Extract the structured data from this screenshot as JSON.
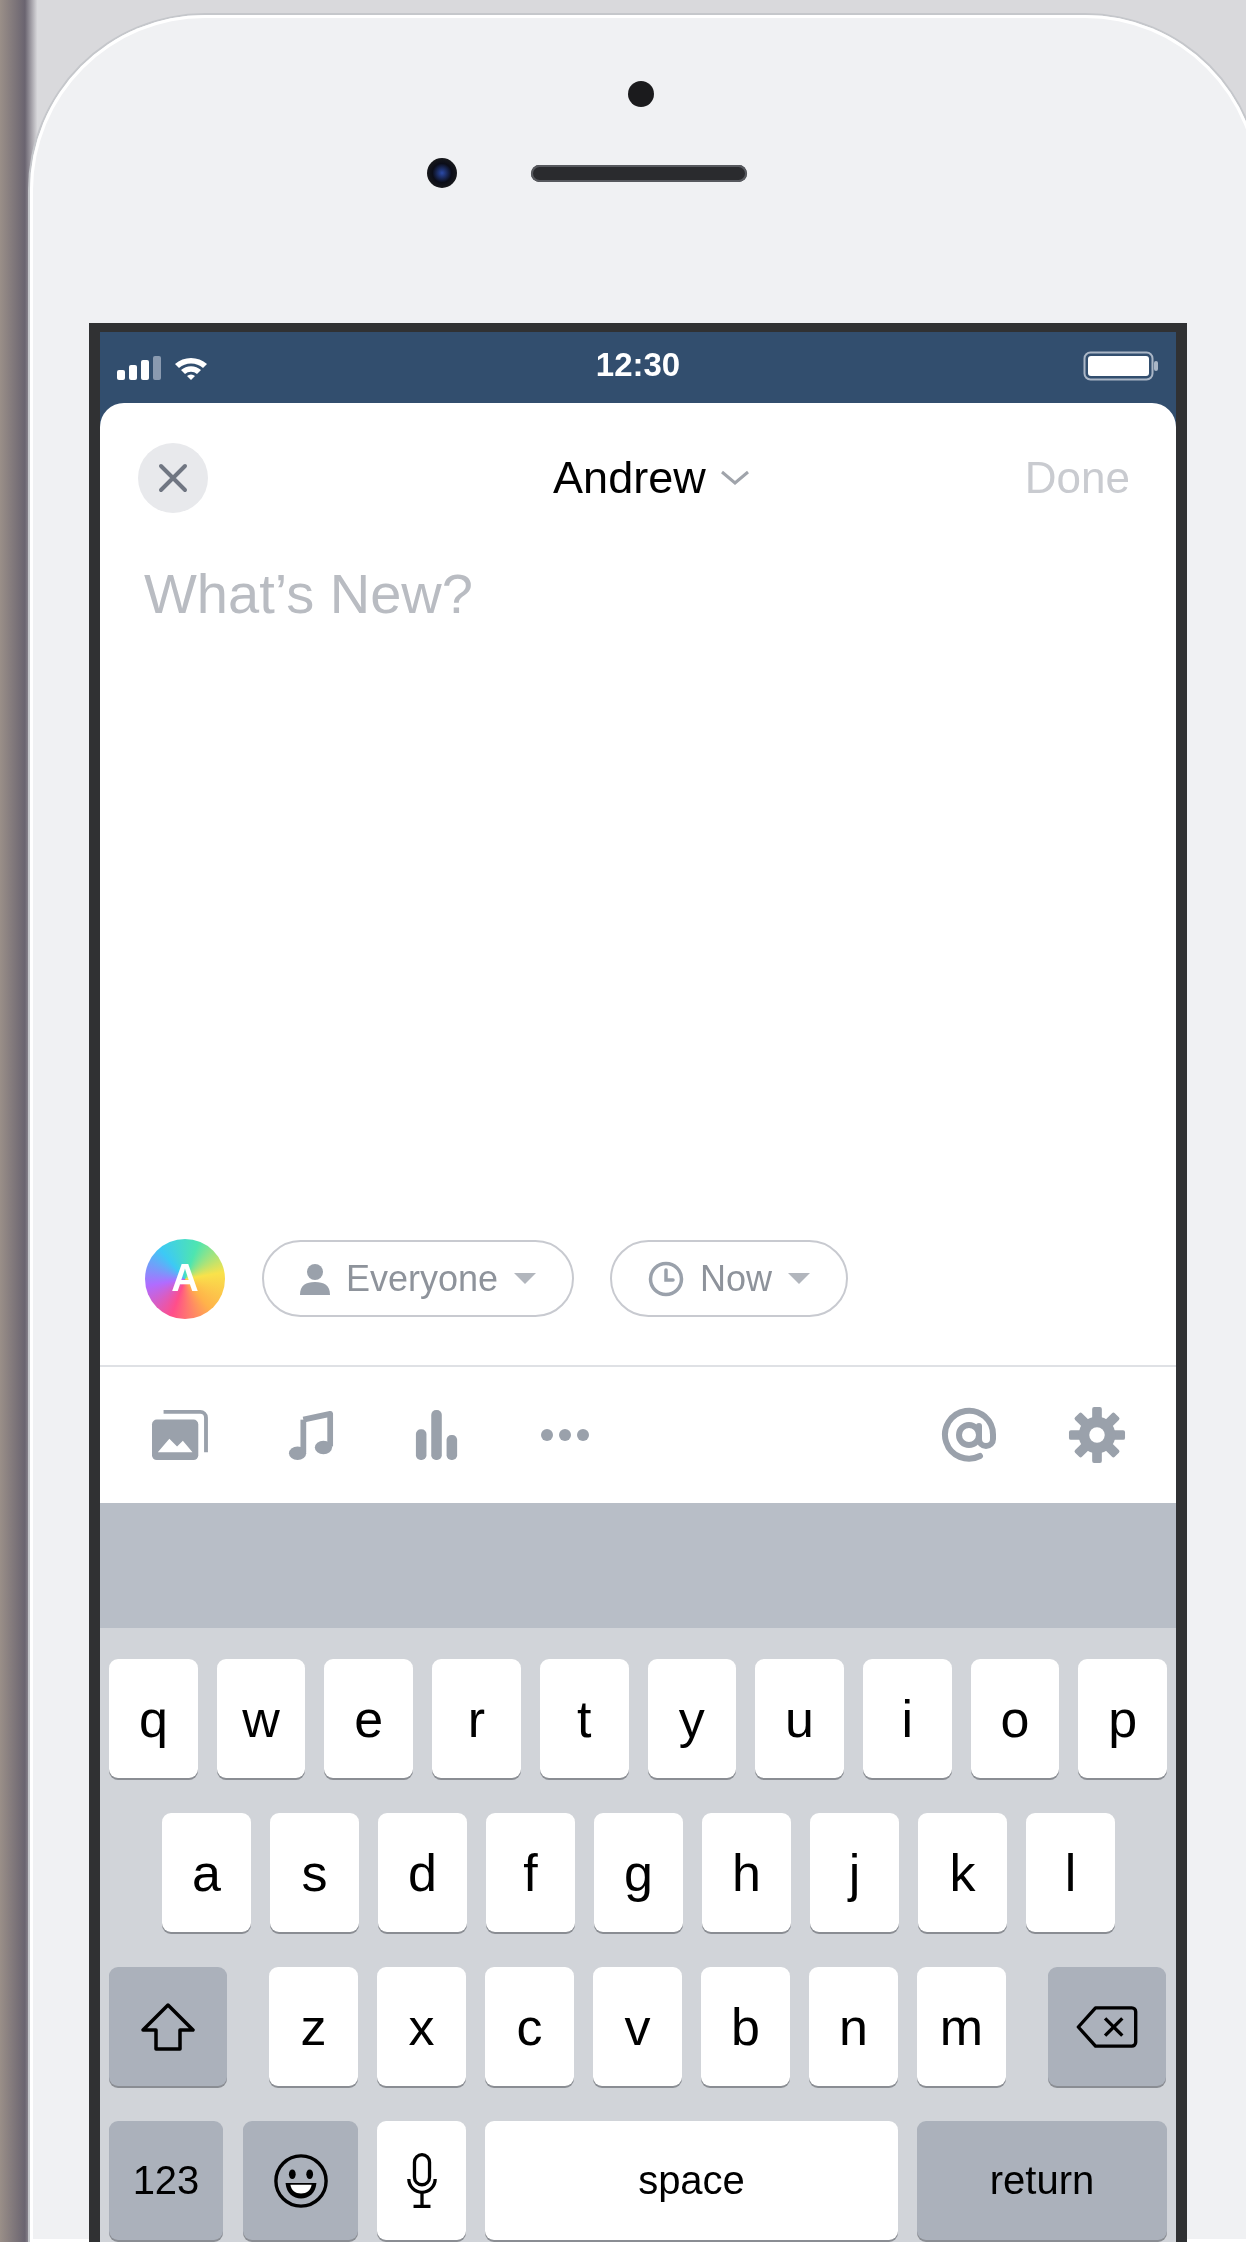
{
  "status_bar": {
    "time": "12:30"
  },
  "header": {
    "title": "Andrew",
    "done": {
      "label": "Done",
      "disabled": true
    }
  },
  "composer": {
    "placeholder": "What’s New?",
    "avatar_letter": "A",
    "options": [
      {
        "kind": "audience",
        "label": "Everyone"
      },
      {
        "kind": "schedule",
        "label": "Now"
      }
    ]
  },
  "keyboard": {
    "rows": [
      {
        "keys": [
          {
            "kind": "letter",
            "label": "q"
          },
          {
            "kind": "letter",
            "label": "w"
          },
          {
            "kind": "letter",
            "label": "e"
          },
          {
            "kind": "letter",
            "label": "r"
          },
          {
            "kind": "letter",
            "label": "t"
          },
          {
            "kind": "letter",
            "label": "y"
          },
          {
            "kind": "letter",
            "label": "u"
          },
          {
            "kind": "letter",
            "label": "i"
          },
          {
            "kind": "letter",
            "label": "o"
          },
          {
            "kind": "letter",
            "label": "p"
          }
        ]
      },
      {
        "keys": [
          {
            "kind": "letter",
            "label": "a"
          },
          {
            "kind": "letter",
            "label": "s"
          },
          {
            "kind": "letter",
            "label": "d"
          },
          {
            "kind": "letter",
            "label": "f"
          },
          {
            "kind": "letter",
            "label": "g"
          },
          {
            "kind": "letter",
            "label": "h"
          },
          {
            "kind": "letter",
            "label": "j"
          },
          {
            "kind": "letter",
            "label": "k"
          },
          {
            "kind": "letter",
            "label": "l"
          }
        ]
      },
      {
        "keys": [
          {
            "kind": "shift"
          },
          {
            "kind": "letter",
            "label": "z"
          },
          {
            "kind": "letter",
            "label": "x"
          },
          {
            "kind": "letter",
            "label": "c"
          },
          {
            "kind": "letter",
            "label": "v"
          },
          {
            "kind": "letter",
            "label": "b"
          },
          {
            "kind": "letter",
            "label": "n"
          },
          {
            "kind": "letter",
            "label": "m"
          },
          {
            "kind": "delete"
          }
        ]
      },
      {
        "keys": [
          {
            "kind": "numbers",
            "label": "123"
          },
          {
            "kind": "emoji"
          },
          {
            "kind": "mic"
          },
          {
            "kind": "space",
            "label": "space"
          },
          {
            "kind": "return",
            "label": "return"
          }
        ]
      }
    ]
  }
}
